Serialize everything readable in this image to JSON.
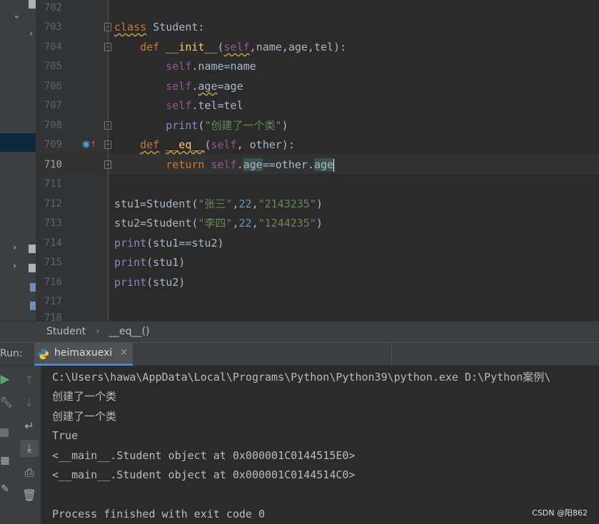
{
  "editor": {
    "line_numbers": [
      "702",
      "703",
      "704",
      "705",
      "706",
      "707",
      "708",
      "709",
      "710",
      "711",
      "712",
      "713",
      "714",
      "715",
      "716",
      "717",
      "718"
    ],
    "current_line": "710"
  },
  "breadcrumb": {
    "class_name": "Student",
    "method_name": "__eq__()"
  },
  "run": {
    "label": "Run:",
    "tab_label": "heimaxuexi",
    "tab_close": "×",
    "console_lines": [
      "C:\\Users\\hawa\\AppData\\Local\\Programs\\Python\\Python39\\python.exe D:\\Python案例\\",
      "创建了一个类",
      "创建了一个类",
      "True",
      "<__main__.Student object at 0x000001C0144515E0>",
      "<__main__.Student object at 0x000001C0144514C0>",
      "",
      "Process finished with exit code 0"
    ]
  },
  "watermark": "CSDN @阳862",
  "icons": {
    "run": "run-icon",
    "rerun_up": "scroll-up-icon",
    "rerun_down": "scroll-down-icon",
    "wrap": "soft-wrap-icon",
    "scroll_end": "scroll-to-end-icon",
    "print": "print-icon",
    "trash": "trash-icon",
    "wrench": "wrench-icon",
    "stop": "stop-icon",
    "layout": "layout-icon",
    "pin": "pin-icon",
    "python": "python-icon",
    "override": "override-icon"
  },
  "colors": {
    "accent": "#4a88c7",
    "keyword": "#cc7832",
    "string": "#6a8759",
    "self": "#94558d",
    "number": "#6897bb"
  }
}
